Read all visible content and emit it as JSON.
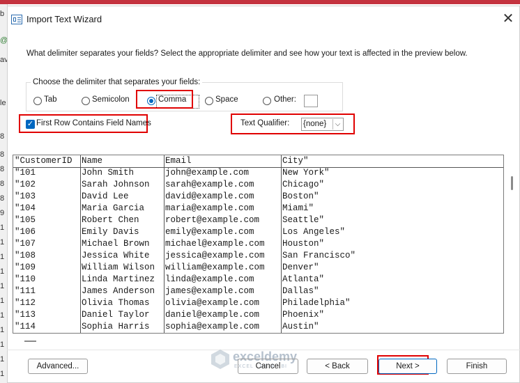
{
  "window": {
    "title": "Import Text Wizard",
    "close_glyph": "✕"
  },
  "background": {
    "left_strip": [
      "b",
      "@",
      "av",
      "le",
      "8",
      "8",
      "8",
      "8",
      "8",
      "9",
      "1",
      "1",
      "1",
      "1",
      "1",
      "1",
      "1",
      "1",
      "1",
      "1",
      "1"
    ]
  },
  "instruction": "What delimiter separates your fields? Select the appropriate delimiter and see how your text is affected in the preview below.",
  "delimiter_group": {
    "label": "Choose the delimiter that separates your fields:",
    "options": [
      {
        "label": "Tab",
        "selected": false
      },
      {
        "label": "Semicolon",
        "selected": false
      },
      {
        "label": "Comma",
        "selected": true
      },
      {
        "label": "Space",
        "selected": false
      },
      {
        "label": "Other:",
        "selected": false
      }
    ],
    "other_value": ""
  },
  "first_row_checkbox": {
    "label": "First Row Contains Field Names",
    "checked": true
  },
  "text_qualifier": {
    "label": "Text Qualifier:",
    "value": "{none}"
  },
  "preview": {
    "headers": [
      "\"CustomerID",
      "Name",
      "Email",
      "City\""
    ],
    "rows": [
      [
        "\"101",
        "John Smith",
        "john@example.com",
        "New York\""
      ],
      [
        "\"102",
        "Sarah Johnson",
        "sarah@example.com",
        "Chicago\""
      ],
      [
        "\"103",
        "David Lee",
        "david@example.com",
        "Boston\""
      ],
      [
        "\"104",
        "Maria Garcia",
        "maria@example.com",
        "Miami\""
      ],
      [
        "\"105",
        "Robert Chen",
        "robert@example.com",
        "Seattle\""
      ],
      [
        "\"106",
        "Emily Davis",
        "emily@example.com",
        "Los Angeles\""
      ],
      [
        "\"107",
        "Michael Brown",
        "michael@example.com",
        "Houston\""
      ],
      [
        "\"108",
        "Jessica White",
        "jessica@example.com",
        "San Francisco\""
      ],
      [
        "\"109",
        "William Wilson",
        "william@example.com",
        "Denver\""
      ],
      [
        "\"110",
        "Linda Martinez",
        "linda@example.com",
        "Atlanta\""
      ],
      [
        "\"111",
        "James Anderson",
        "james@example.com",
        "Dallas\""
      ],
      [
        "\"112",
        "Olivia Thomas",
        "olivia@example.com",
        "Philadelphia\""
      ],
      [
        "\"113",
        "Daniel Taylor",
        "daniel@example.com",
        "Phoenix\""
      ],
      [
        "\"114",
        "Sophia Harris",
        "sophia@example.com",
        "Austin\""
      ]
    ]
  },
  "buttons": {
    "advanced": "Advanced...",
    "cancel": "Cancel",
    "back": "< Back",
    "next": "Next >",
    "finish": "Finish"
  },
  "watermark": {
    "name": "exceldemy",
    "tagline": "EXCEL · DATA · BI"
  },
  "colors": {
    "accent": "#0067c0",
    "highlight": "#e00000",
    "excel_red": "#c4333f"
  }
}
